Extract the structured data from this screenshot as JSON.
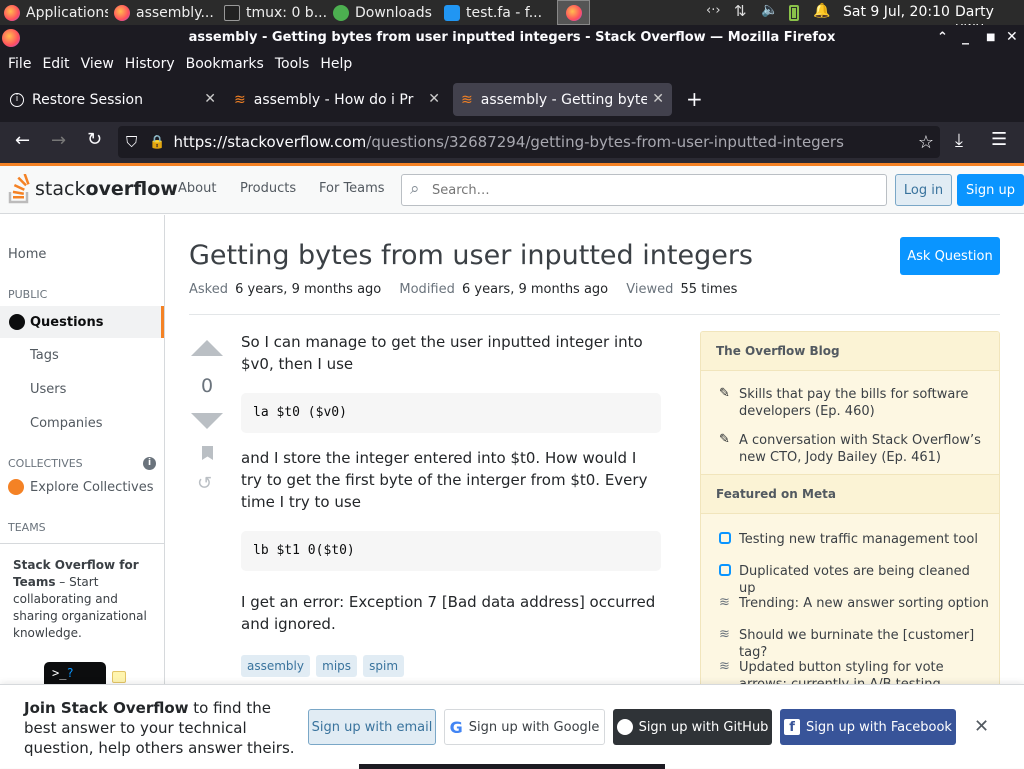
{
  "os_panel": {
    "applications": "Applications",
    "tasks": [
      {
        "label": "assembly..."
      },
      {
        "label": "tmux: 0 b..."
      },
      {
        "label": "Downloads"
      },
      {
        "label": "test.fa - f..."
      }
    ],
    "clock": "Sat  9 Jul, 20:10",
    "user": "Darty uwu"
  },
  "window": {
    "title": "assembly - Getting bytes from user inputted integers - Stack Overflow — Mozilla Firefox"
  },
  "menubar": [
    "File",
    "Edit",
    "View",
    "History",
    "Bookmarks",
    "Tools",
    "Help"
  ],
  "tabs": [
    {
      "label": "Restore Session"
    },
    {
      "label": "assembly - How do i Print"
    },
    {
      "label": "assembly - Getting bytes"
    }
  ],
  "url": {
    "domain": "https://stackoverflow.com",
    "path": "/questions/32687294/getting-bytes-from-user-inputted-integers"
  },
  "so_header": {
    "logo_light": "stack",
    "logo_bold": "overflow",
    "nav": [
      "About",
      "Products",
      "For Teams"
    ],
    "search_placeholder": "Search…",
    "login": "Log in",
    "signup": "Sign up"
  },
  "left_nav": {
    "home": "Home",
    "public": "PUBLIC",
    "questions": "Questions",
    "tags": "Tags",
    "users": "Users",
    "companies": "Companies",
    "collectives": "COLLECTIVES",
    "explore": "Explore Collectives",
    "teams": "TEAMS",
    "teams_title": "Stack Overflow for Teams",
    "teams_text": " – Start collaborating and sharing organizational knowledge."
  },
  "question": {
    "title": "Getting bytes from user inputted integers",
    "ask_button": "Ask Question",
    "asked_label": "Asked",
    "asked_value": "6 years, 9 months ago",
    "modified_label": "Modified",
    "modified_value": "6 years, 9 months ago",
    "viewed_label": "Viewed",
    "viewed_value": "55 times",
    "votes": "0",
    "para1": "So I can manage to get the user inputted integer into $v0, then I use",
    "code1": "la $t0 ($v0)",
    "para2": "and I store the integer entered into $t0. How would I try to get the first byte of the interger from $t0. Every time I try to use",
    "code2": "lb $t1 0($t0)",
    "para3": "I get an error: Exception 7 [Bad data address] occurred and ignored.",
    "tags": [
      "assembly",
      "mips",
      "spim"
    ]
  },
  "sidebar": {
    "blog_title": "The Overflow Blog",
    "blog_items": [
      "Skills that pay the bills for software developers (Ep. 460)",
      "A conversation with Stack Overflow’s new CTO, Jody Bailey (Ep. 461)"
    ],
    "meta_title": "Featured on Meta",
    "meta_items": [
      "Testing new traffic management tool",
      "Duplicated votes are being cleaned up",
      "Trending: A new answer sorting option",
      "Should we burninate the [customer] tag?",
      "Updated button styling for vote arrows: currently in A/B testing"
    ]
  },
  "banner": {
    "bold": "Join Stack Overflow",
    "rest": " to find the best answer to your technical question, help others answer theirs.",
    "email": "Sign up with email",
    "google": "Sign up with Google",
    "github": "Sign up with GitHub",
    "facebook": "Sign up with Facebook"
  },
  "colors": {
    "accent": "#0a95ff",
    "orange": "#f48225",
    "github": "#2f3337",
    "facebook": "#385499"
  }
}
